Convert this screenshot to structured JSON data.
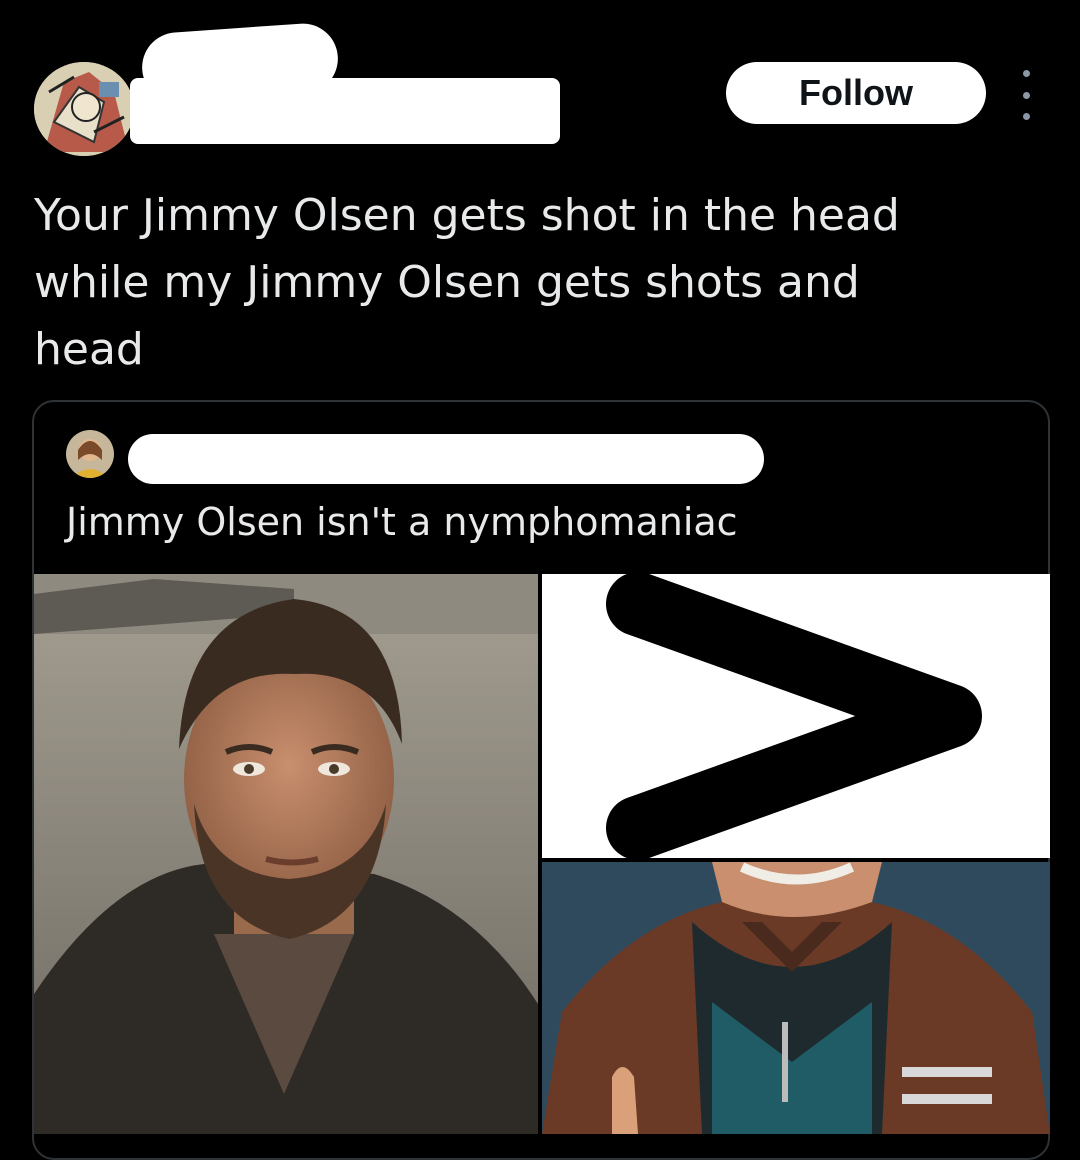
{
  "post": {
    "follow_label": "Follow",
    "text": "Your Jimmy Olsen gets shot in the head\nwhile my Jimmy Olsen gets shots and\nhead",
    "icons": [
      "avatar",
      "more-options-icon"
    ]
  },
  "quoted_post": {
    "text": "Jimmy Olsen isn't a nymphomaniac",
    "media_symbol": ">"
  }
}
